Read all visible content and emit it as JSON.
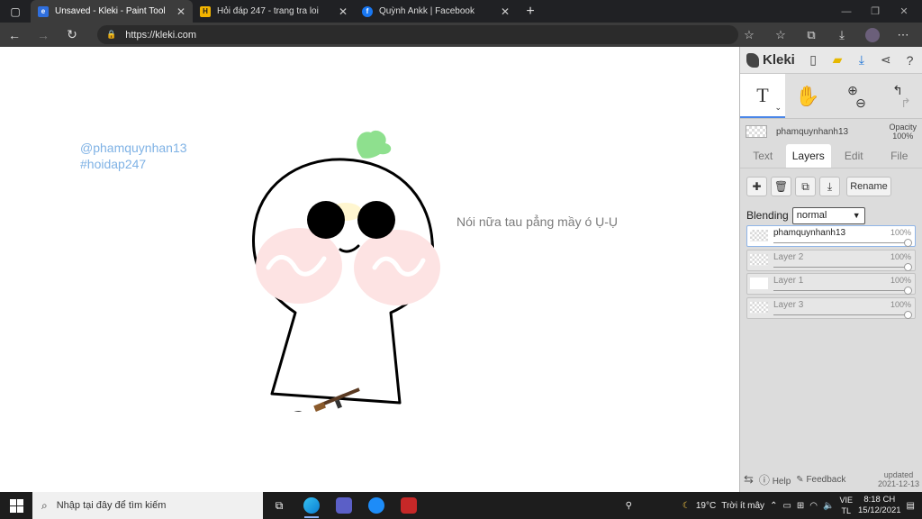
{
  "browser": {
    "tabs": [
      {
        "title": "Unsaved - Kleki - Paint Tool",
        "favicon_color": "#2f6fde",
        "active": true
      },
      {
        "title": "Hỏi đáp 247 - trang tra loi",
        "favicon_color": "#f2b400",
        "active": false
      },
      {
        "title": "Quỳnh Ankk | Facebook",
        "favicon_color": "#1877f2",
        "active": false
      }
    ],
    "url": "https://kleki.com"
  },
  "canvas": {
    "watermark_line1": "@phamquynhan13",
    "watermark_line2": "#hoidap247",
    "caption": "Nói nữa tau pẳng mầy ó Ụ-Ụ"
  },
  "panel": {
    "logo": "Kleki",
    "brush_name": "phamquynhanh13",
    "opacity_label": "Opacity",
    "opacity_value": "100%",
    "tabs": [
      "Text",
      "Layers",
      "Edit",
      "File"
    ],
    "active_tab": "Layers",
    "rename_label": "Rename",
    "blending_label": "Blending",
    "blending_value": "normal",
    "layers": [
      {
        "name": "phamquynhanh13",
        "opacity": "100%",
        "active": true
      },
      {
        "name": "Layer 2",
        "opacity": "100%",
        "active": false
      },
      {
        "name": "Layer 1",
        "opacity": "100%",
        "active": false
      },
      {
        "name": "Layer 3",
        "opacity": "100%",
        "active": false
      }
    ],
    "help_label": "Help",
    "feedback_label": "Feedback",
    "updated_label": "updated",
    "updated_date": "2021-12-13"
  },
  "taskbar": {
    "search_placeholder": "Nhập tại đây để tìm kiếm",
    "weather_temp": "19°C",
    "weather_text": "Trời ít mây",
    "lang_line1": "VIE",
    "lang_line2": "TL",
    "time": "8:18 CH",
    "date": "15/12/2021"
  },
  "colors": {
    "accent": "#4a86e8",
    "watermark": "#7fb2e5",
    "cheek": "#fde3e3",
    "sprout": "#8ee08e"
  }
}
